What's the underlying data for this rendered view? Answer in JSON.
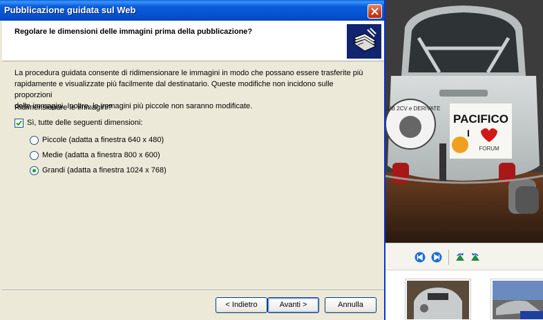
{
  "window": {
    "title": "Pubblicazione guidata sul Web",
    "close_icon": "close-icon"
  },
  "header": {
    "title": "Regolare le dimensioni delle immagini prima della pubblicazione?",
    "icon": "publish-wizard-icon"
  },
  "content": {
    "intro_line1": "La procedura guidata consente di ridimensionare le immagini in modo che possano essere trasferite più",
    "intro_line2": "rapidamente e visualizzate più facilmente dal destinatario. Queste modifiche non incidono sulle proporzioni",
    "intro_line3": "delle immagini. Inoltre, le immagini più piccole non saranno modificate.",
    "question": "Ridimensionare le immagini?",
    "resize_checkbox": {
      "label": "Sì, tutte delle seguenti dimensioni:",
      "checked": true
    },
    "sizes": [
      {
        "label": "Piccole (adatta a finestra 640 x 480)",
        "selected": false
      },
      {
        "label": "Medie (adatta a finestra 800 x 600)",
        "selected": false
      },
      {
        "label": "Grandi (adatta a finestra 1024 x 768)",
        "selected": true
      }
    ]
  },
  "buttons": {
    "back": "< Indietro",
    "next": "Avanti >",
    "cancel": "Annulla"
  },
  "viewer": {
    "photo_text": [
      "PACIFICO",
      "I",
      "FORUM",
      "CLUB 2CV e DERIVATE"
    ],
    "toolbar": [
      "previous-image-icon",
      "next-image-icon",
      "rotate-clockwise-icon",
      "rotate-counterclockwise-icon"
    ]
  },
  "colors": {
    "titlebar": "#0a5fd8",
    "dialog_bg": "#ece9d8",
    "radio_dot": "#21a121",
    "check_mark": "#21a121"
  }
}
